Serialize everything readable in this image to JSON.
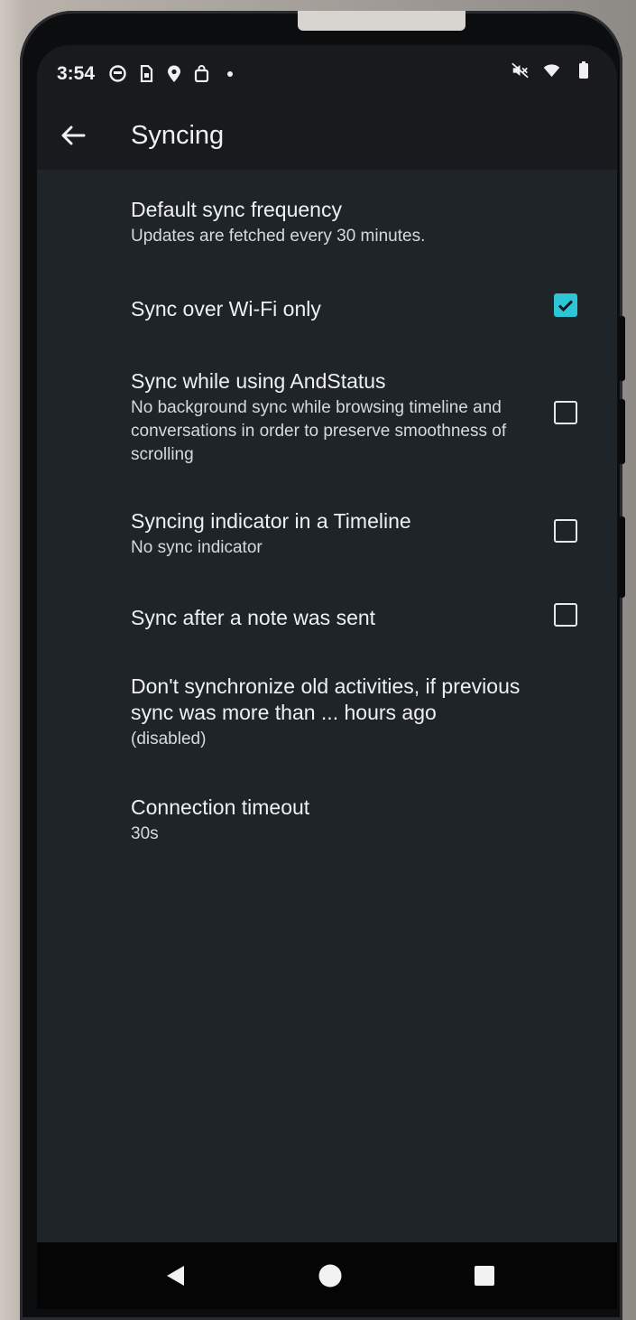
{
  "status_bar": {
    "time": "3:54",
    "left_icons": [
      "face-icon",
      "sim-icon",
      "location-icon",
      "bag-icon",
      "dot-icon"
    ],
    "right_icons": [
      "mute-icon",
      "wifi-icon",
      "battery-icon"
    ]
  },
  "app_bar": {
    "title": "Syncing",
    "back_icon": "arrow-back-icon"
  },
  "settings": [
    {
      "title": "Default sync frequency",
      "summary": "Updates are fetched every 30 minutes."
    },
    {
      "title": "Sync over Wi-Fi only",
      "checked": true
    },
    {
      "title": "Sync while using AndStatus",
      "summary": "No background sync while browsing timeline and conversations in order to preserve smoothness of scrolling",
      "checked": false
    },
    {
      "title": "Syncing indicator in a Timeline",
      "summary": "No sync indicator",
      "checked": false
    },
    {
      "title": "Sync after a note was sent",
      "checked": false
    },
    {
      "title": "Don't synchronize old activities, if previous sync was more than ... hours ago",
      "summary": "(disabled)"
    },
    {
      "title": "Connection timeout",
      "summary": "30s"
    }
  ],
  "nav_bar": [
    "back-triangle-icon",
    "home-circle-icon",
    "recents-square-icon"
  ],
  "colors": {
    "accent": "#2cc6d6",
    "background": "#1f2429",
    "appbar": "#181a1d"
  }
}
